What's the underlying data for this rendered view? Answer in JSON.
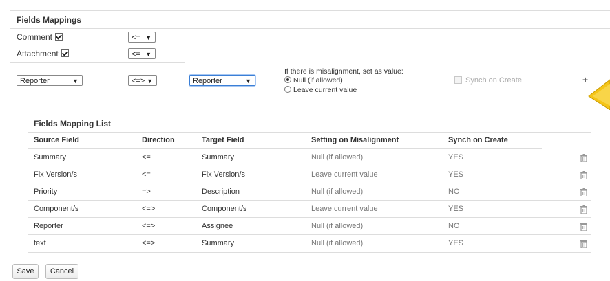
{
  "fields_mappings": {
    "title": "Fields Mappings",
    "comment": {
      "label": "Comment",
      "direction": "<="
    },
    "attachment": {
      "label": "Attachment",
      "direction": "<="
    },
    "new_mapping": {
      "source": "Reporter",
      "direction": "<=>",
      "target": "Reporter",
      "misalignment_prompt": "If there is misalignment, set as value:",
      "option_null": "Null (if allowed)",
      "option_leave": "Leave current value",
      "synch_on_create": "Synch on Create",
      "add_symbol": "+"
    }
  },
  "mapping_list": {
    "title": "Fields Mapping List",
    "headers": [
      "Source Field",
      "Direction",
      "Target Field",
      "Setting on Misalignment",
      "Synch on Create"
    ],
    "rows": [
      {
        "source": "Summary",
        "direction": "<=",
        "target": "Summary",
        "setting": "Null (if allowed)",
        "synch": "YES"
      },
      {
        "source": "Fix Version/s",
        "direction": "<=",
        "target": "Fix Version/s",
        "setting": "Leave current value",
        "synch": "YES"
      },
      {
        "source": "Priority",
        "direction": "=>",
        "target": "Description",
        "setting": "Null (if allowed)",
        "synch": "NO"
      },
      {
        "source": "Component/s",
        "direction": "<=>",
        "target": "Component/s",
        "setting": "Leave current value",
        "synch": "YES"
      },
      {
        "source": "Reporter",
        "direction": "<=>",
        "target": "Assignee",
        "setting": "Null (if allowed)",
        "synch": "NO"
      },
      {
        "source": "text",
        "direction": "<=>",
        "target": "Summary",
        "setting": "Null (if allowed)",
        "synch": "YES"
      }
    ]
  },
  "actions": {
    "save": "Save",
    "cancel": "Cancel"
  },
  "icons": {
    "delete": "trash-icon",
    "add": "plus-icon",
    "pointer": "arrow-cursor-icon"
  },
  "colors": {
    "pointer": "#f5c518",
    "border": "#dddddd",
    "focus": "#3b7fd6"
  }
}
